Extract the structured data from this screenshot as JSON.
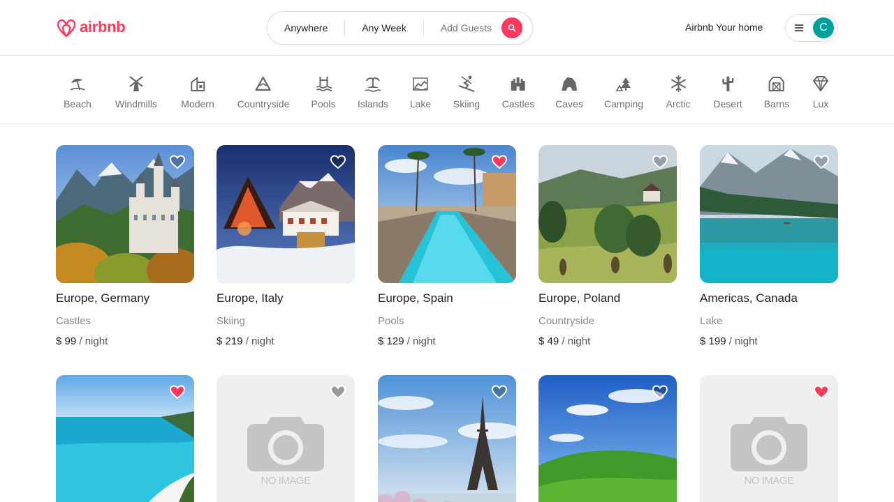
{
  "brand": {
    "name": "airbnb",
    "color": "#ff385c"
  },
  "search": {
    "where": "Anywhere",
    "when": "Any Week",
    "guests": "Add Guests"
  },
  "header": {
    "host_link": "Airbnb Your home",
    "avatar_initial": "C",
    "avatar_color": "#00a19a"
  },
  "categories": [
    {
      "label": "Beach",
      "icon": "beach-icon"
    },
    {
      "label": "Windmills",
      "icon": "windmill-icon"
    },
    {
      "label": "Modern",
      "icon": "modern-house-icon"
    },
    {
      "label": "Countryside",
      "icon": "countryside-icon"
    },
    {
      "label": "Pools",
      "icon": "pool-icon"
    },
    {
      "label": "Islands",
      "icon": "island-icon"
    },
    {
      "label": "Lake",
      "icon": "lake-icon"
    },
    {
      "label": "Skiing",
      "icon": "skiing-icon"
    },
    {
      "label": "Castles",
      "icon": "castle-icon"
    },
    {
      "label": "Caves",
      "icon": "cave-icon"
    },
    {
      "label": "Camping",
      "icon": "camping-icon"
    },
    {
      "label": "Arctic",
      "icon": "snowflake-icon"
    },
    {
      "label": "Desert",
      "icon": "cactus-icon"
    },
    {
      "label": "Barns",
      "icon": "barn-icon"
    },
    {
      "label": "Lux",
      "icon": "diamond-icon"
    }
  ],
  "listings": [
    {
      "location": "Europe, Germany",
      "category": "Castles",
      "price": "$ 99",
      "per": "/ night",
      "favorite": false
    },
    {
      "location": "Europe, Italy",
      "category": "Skiing",
      "price": "$ 219",
      "per": "/ night",
      "favorite": false
    },
    {
      "location": "Europe, Spain",
      "category": "Pools",
      "price": "$ 129",
      "per": "/ night",
      "favorite": true
    },
    {
      "location": "Europe, Poland",
      "category": "Countryside",
      "price": "$ 49",
      "per": "/ night",
      "favorite": false
    },
    {
      "location": "Americas, Canada",
      "category": "Lake",
      "price": "$ 199",
      "per": "/ night",
      "favorite": false
    },
    {
      "favorite": true
    },
    {
      "favorite": false,
      "placeholder": "NO IMAGE"
    },
    {
      "favorite": false
    },
    {
      "favorite": false
    },
    {
      "favorite": true,
      "placeholder": "NO IMAGE"
    }
  ]
}
